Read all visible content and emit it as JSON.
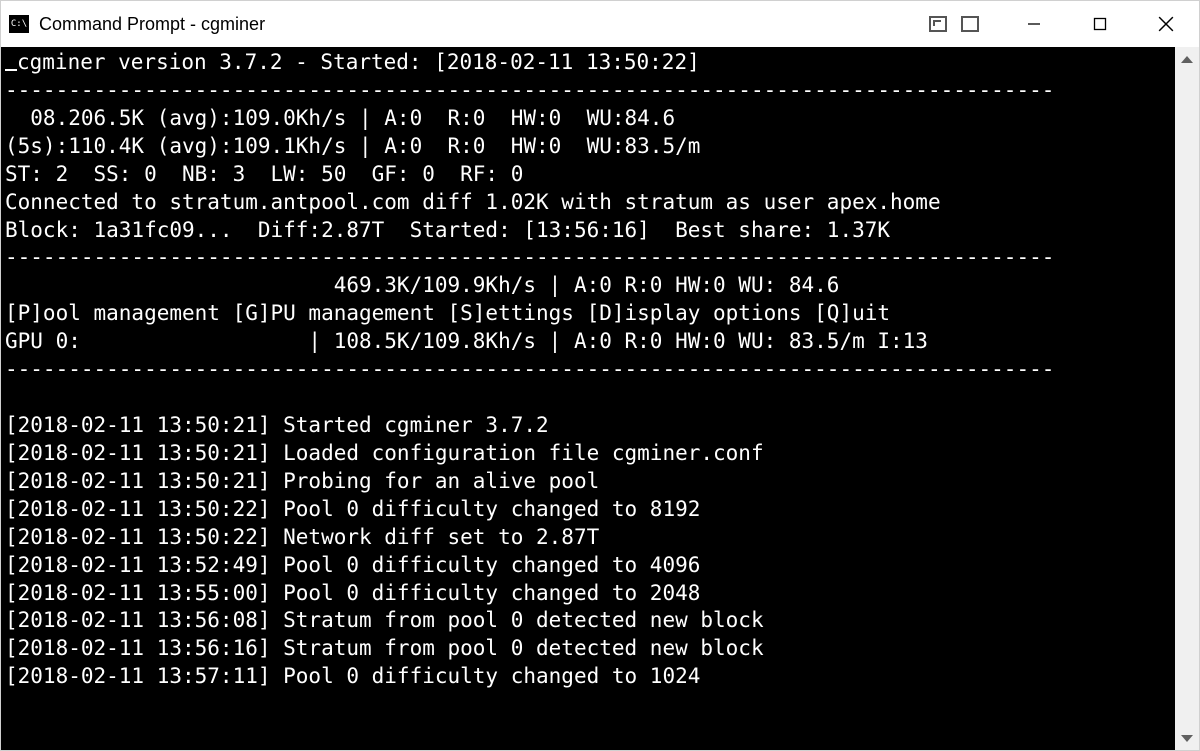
{
  "window": {
    "title": "Command Prompt - cgminer"
  },
  "header": {
    "version_line": "cgminer version 3.7.2 - Started: [2018-02-11 13:50:22]"
  },
  "stats": {
    "line1": "  08.206.5K (avg):109.0Kh/s | A:0  R:0  HW:0  WU:84.6",
    "line2": "(5s):110.4K (avg):109.1Kh/s | A:0  R:0  HW:0  WU:83.5/m",
    "line3": "ST: 2  SS: 0  NB: 3  LW: 50  GF: 0  RF: 0",
    "line4": "Connected to stratum.antpool.com diff 1.02K with stratum as user apex.home",
    "line5": "Block: 1a31fc09...  Diff:2.87T  Started: [13:56:16]  Best share: 1.37K"
  },
  "mid": {
    "line1": "                          469.3K/109.9Kh/s | A:0 R:0 HW:0 WU: 84.6",
    "menu": "[P]ool management [G]PU management [S]ettings [D]isplay options [Q]uit",
    "gpu": "GPU 0:                  | 108.5K/109.8Kh/s | A:0 R:0 HW:0 WU: 83.5/m I:13"
  },
  "log": [
    "[2018-02-11 13:50:21] Started cgminer 3.7.2",
    "[2018-02-11 13:50:21] Loaded configuration file cgminer.conf",
    "[2018-02-11 13:50:21] Probing for an alive pool",
    "[2018-02-11 13:50:22] Pool 0 difficulty changed to 8192",
    "[2018-02-11 13:50:22] Network diff set to 2.87T",
    "[2018-02-11 13:52:49] Pool 0 difficulty changed to 4096",
    "[2018-02-11 13:55:00] Pool 0 difficulty changed to 2048",
    "[2018-02-11 13:56:08] Stratum from pool 0 detected new block",
    "[2018-02-11 13:56:16] Stratum from pool 0 detected new block",
    "[2018-02-11 13:57:11] Pool 0 difficulty changed to 1024"
  ],
  "hr": "-----------------------------------------------------------------------------------"
}
